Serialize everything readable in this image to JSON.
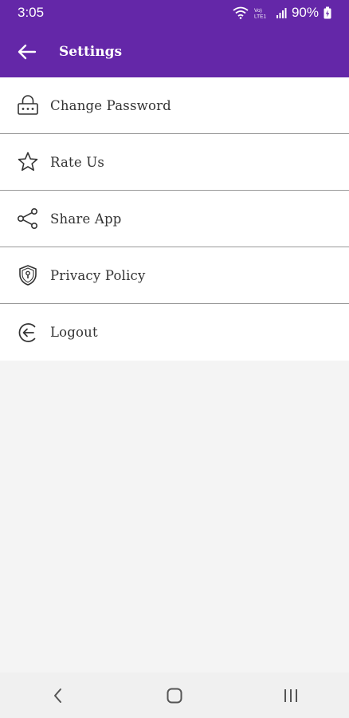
{
  "status_bar": {
    "time": "3:05",
    "battery_percent": "90%",
    "network_label": "Vo) LTE1"
  },
  "app_bar": {
    "title": "Settings",
    "back_icon": "arrow-left-icon"
  },
  "menu": {
    "items": [
      {
        "label": "Change Password",
        "icon": "lock-icon"
      },
      {
        "label": "Rate Us",
        "icon": "star-icon"
      },
      {
        "label": "Share App",
        "icon": "share-icon"
      },
      {
        "label": "Privacy Policy",
        "icon": "shield-icon"
      },
      {
        "label": "Logout",
        "icon": "logout-icon"
      }
    ]
  },
  "nav_bar": {
    "buttons": [
      "back-nav-icon",
      "home-nav-icon",
      "recents-nav-icon"
    ]
  },
  "colors": {
    "primary": "#6427a8",
    "background": "#f4f4f4",
    "divider": "#9a9a9a",
    "text": "#333333"
  }
}
